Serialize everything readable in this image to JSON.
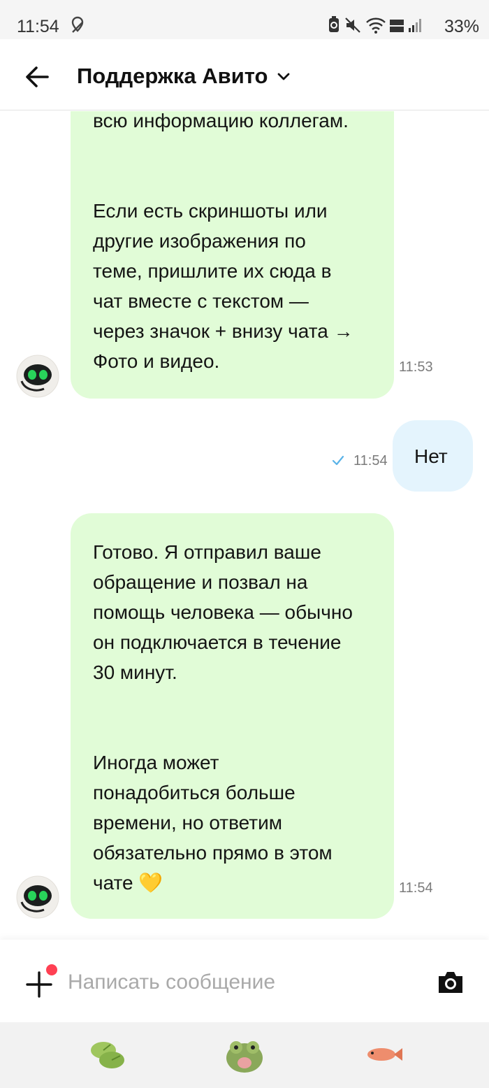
{
  "status_bar": {
    "time": "11:54",
    "battery": "33%"
  },
  "header": {
    "title": "Поддержка Авито"
  },
  "messages": [
    {
      "sender": "bot",
      "text": "всю информацию коллегам.\n\n\nЕсли есть скриншоты или\nдругие изображения по\nтеме, пришлите их сюда в\nчат вместе с текстом —\nчерез значок + внизу чата →\nФото и видео.",
      "time": "11:53"
    },
    {
      "sender": "user",
      "text": "Нет",
      "time": "11:54",
      "status": "sent"
    },
    {
      "sender": "bot",
      "text": "Готово. Я отправил ваше\nобращение и позвал на\nпомощь человека — обычно\nон подключается в течение\n30 минут.\n\n\nИногда может\nпонадобиться больше\nвремени, но ответим\nобязательно прямо в этом\nчате 💛",
      "time": "11:54"
    }
  ],
  "composer": {
    "placeholder": "Написать сообщение",
    "value": ""
  },
  "stickers": [
    "lily-pad-sticker",
    "frog-sticker",
    "fish-sticker"
  ],
  "colors": {
    "bot_bubble": "#e1fcd7",
    "user_bubble": "#e4f4fd",
    "unread_dot": "#ff4053",
    "read_check": "#5ab3e8"
  }
}
